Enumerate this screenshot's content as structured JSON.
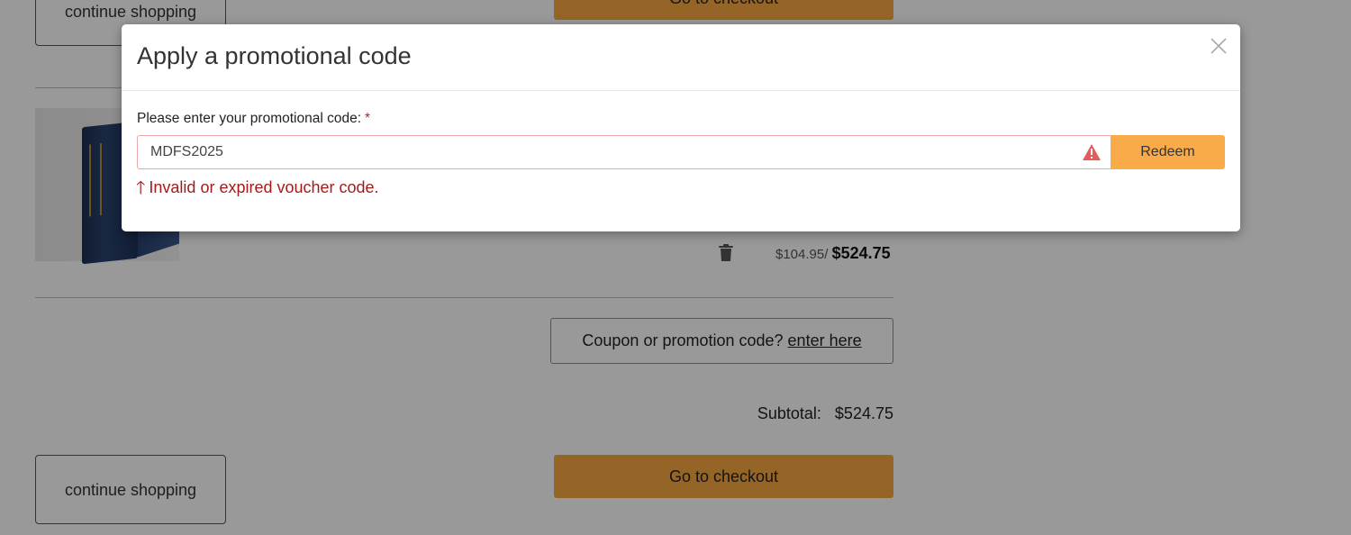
{
  "page": {
    "continue_label": "continue shopping",
    "checkout_label": "Go to checkout",
    "price_unit": "$104.95/",
    "price_total": "$524.75",
    "coupon_prompt": "Coupon or promotion code?",
    "coupon_link": "enter here",
    "subtotal_label": "Subtotal:",
    "subtotal_value": "$524.75"
  },
  "modal": {
    "title": "Apply a promotional code",
    "field_label": "Please enter your promotional code:",
    "required_marker": "*",
    "code_value": "MDFS2025",
    "redeem_label": "Redeem",
    "error_arrow": "🡑",
    "error_message": "Invalid or expired voucher code."
  },
  "colors": {
    "accent_orange": "#f8ab48",
    "error_red": "#a61a1a",
    "coupon_border": "#7fa63a"
  },
  "icons": [
    "close-icon",
    "warning-icon",
    "trash-icon",
    "arrow-up-icon"
  ]
}
